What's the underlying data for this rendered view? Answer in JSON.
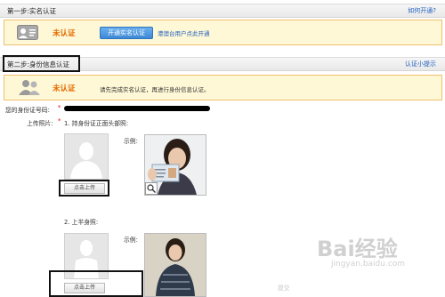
{
  "step1": {
    "title": "第一步:实名认证",
    "help_link": "如何开通?",
    "status": "未认证",
    "button": "开通实名认证",
    "link": "港澳台用户点此开通"
  },
  "step2": {
    "title": "第二步:身份信息认证",
    "help_link": "认证小提示",
    "status": "未认证",
    "message": "请先完成实名认证，再进行身份信息认证。"
  },
  "form": {
    "id_label": "您的身份证号码:",
    "id_required": "*",
    "upload_label": "上传照片:",
    "upload_required": "*",
    "item1_label": "1. 持身份证正面头部照:",
    "item2_label": "2. 上半身照:",
    "example_label_1": "示例:",
    "example_label_2": "示例:",
    "upload_button_1": "点击上传",
    "upload_button_2": "点击上传",
    "submit": "提交"
  },
  "watermark": {
    "brand": "Bai经验",
    "url": "jingyan.baidu.com"
  },
  "colors": {
    "accent_blue": "#3d88d6",
    "status_orange": "#e26a00",
    "notice_bg": "#fff8d6",
    "required_red": "#e60000"
  }
}
